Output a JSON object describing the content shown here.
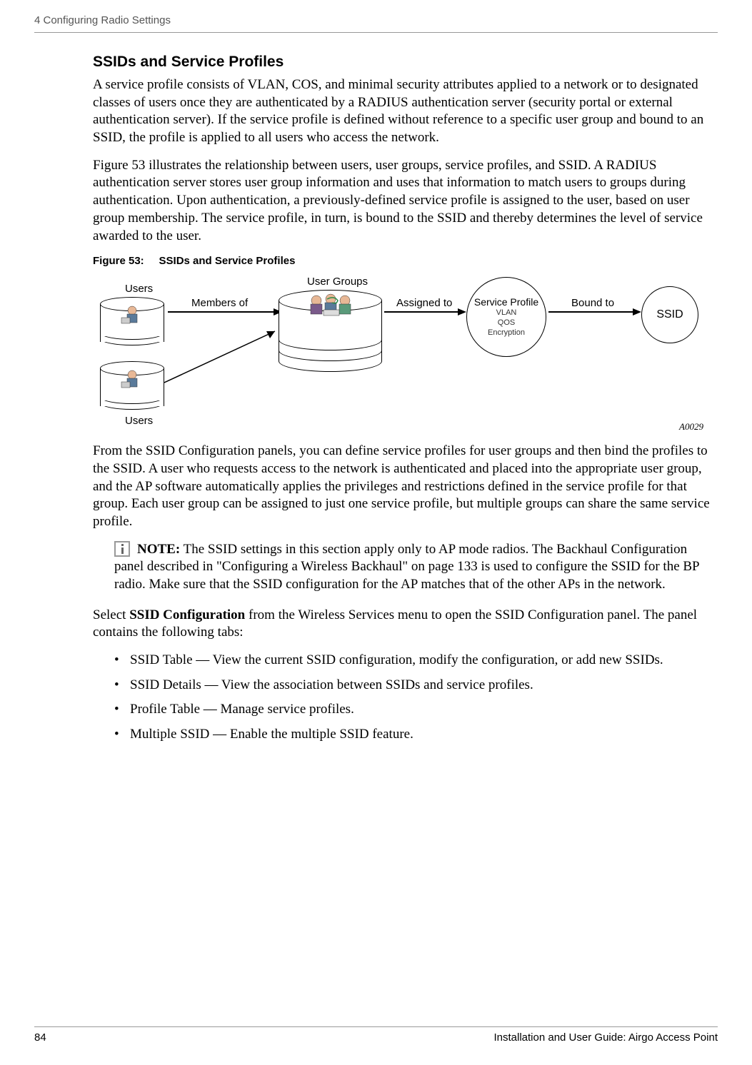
{
  "header": {
    "chapter": "4  Configuring Radio Settings"
  },
  "section": {
    "title": "SSIDs and Service Profiles",
    "para1": "A service profile consists of VLAN, COS, and minimal security attributes applied to a network or to designated classes of users once they are authenticated by a RADIUS authentication server (security portal or external authentication server). If the service profile is defined without reference to a specific user group and bound to an SSID, the profile is applied to all users who access the network.",
    "para2": "Figure 53 illustrates the relationship between users, user groups, service profiles, and SSID. A RADIUS authentication server stores user group information and uses that information to match users to groups during authentication. Upon authentication, a previously-defined service profile is assigned to the user, based on user group membership. The service profile, in turn, is bound to the SSID and thereby determines the level of service awarded to the user."
  },
  "figure": {
    "label": "Figure 53:",
    "title": "SSIDs and Service Profiles",
    "users_top": "Users",
    "users_bottom": "Users",
    "user_groups": "User Groups",
    "members_of": "Members of",
    "assigned_to": "Assigned to",
    "bound_to": "Bound to",
    "service_profile": "Service Profile",
    "vlan": "VLAN",
    "qos": "QOS",
    "encryption": "Encryption",
    "ssid": "SSID",
    "ref": "A0029"
  },
  "para3": "From the SSID Configuration panels, you can define service profiles for user groups and then bind the profiles to the SSID. A user who requests access to the network is authenticated and placed into the appropriate user group, and the AP software automatically applies the privileges and restrictions defined in the service profile for that group. Each user group can be assigned to just one service profile, but multiple groups can share the same service profile.",
  "note": {
    "label": "NOTE:",
    "text": " The SSID settings in this section apply only to AP mode radios. The Backhaul Configuration panel described in \"Configuring a Wireless Backhaul\" on page 133 is used to configure the SSID for the BP radio. Make sure that the SSID configuration for the AP matches that of the other APs in the network."
  },
  "para4_prefix": "Select ",
  "para4_bold": "SSID Configuration",
  "para4_suffix": " from the Wireless Services menu to open the SSID Configuration panel. The panel contains the following tabs:",
  "bullets": [
    "SSID Table — View the current SSID configuration, modify the configuration, or add new SSIDs.",
    "SSID Details — View the association between SSIDs and service profiles.",
    "Profile Table — Manage service profiles.",
    "Multiple SSID — Enable the multiple SSID feature."
  ],
  "footer": {
    "page": "84",
    "guide": "Installation and User Guide: Airgo Access Point"
  }
}
